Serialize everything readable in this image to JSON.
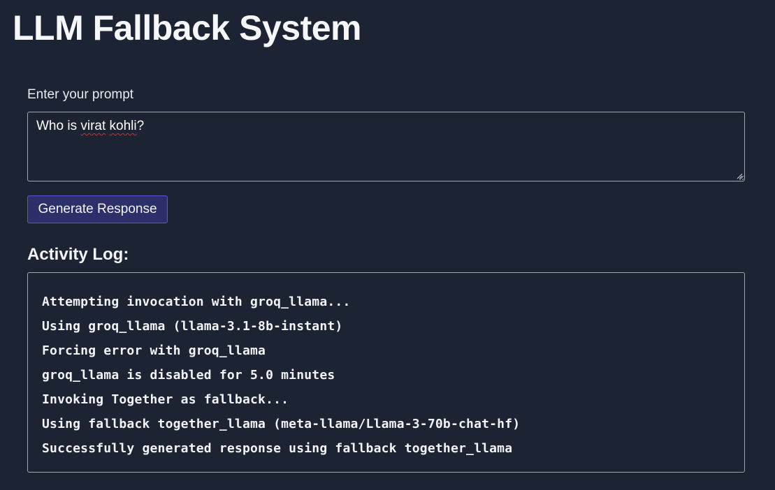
{
  "page": {
    "title": "LLM Fallback System"
  },
  "prompt": {
    "label": "Enter your prompt",
    "value_parts": [
      "Who is ",
      "virat",
      " ",
      "kohli",
      "?"
    ]
  },
  "actions": {
    "generate_label": "Generate Response"
  },
  "log": {
    "heading": "Activity Log:",
    "lines": [
      "Attempting invocation with groq_llama...",
      "Using groq_llama (llama-3.1-8b-instant)",
      "Forcing error with groq_llama",
      "groq_llama is disabled for 5.0 minutes",
      "Invoking Together as fallback...",
      "Using fallback together_llama (meta-llama/Llama-3-70b-chat-hf)",
      "Successfully generated response using fallback together_llama"
    ]
  },
  "colors": {
    "background": "#1c2333",
    "button_background": "#2c2f69",
    "button_border": "#5b55d6",
    "border": "#a3a9b3",
    "spellcheck_underline": "#e02b2b"
  }
}
